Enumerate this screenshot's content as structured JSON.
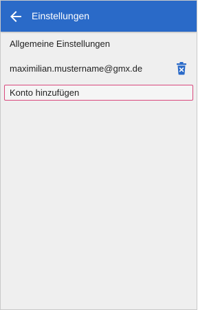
{
  "app_bar": {
    "title": "Einstellungen",
    "back_icon": "arrow-left-icon",
    "background": "#2a6ac8"
  },
  "settings": {
    "general_label": "Allgemeine Einstellungen",
    "account_email": "maximilian.mustername@gmx.de",
    "delete_icon": "trash-icon",
    "delete_icon_color": "#2a6ac8",
    "add_account_label": "Konto hinzufügen",
    "add_account_border": "#d9477c"
  }
}
